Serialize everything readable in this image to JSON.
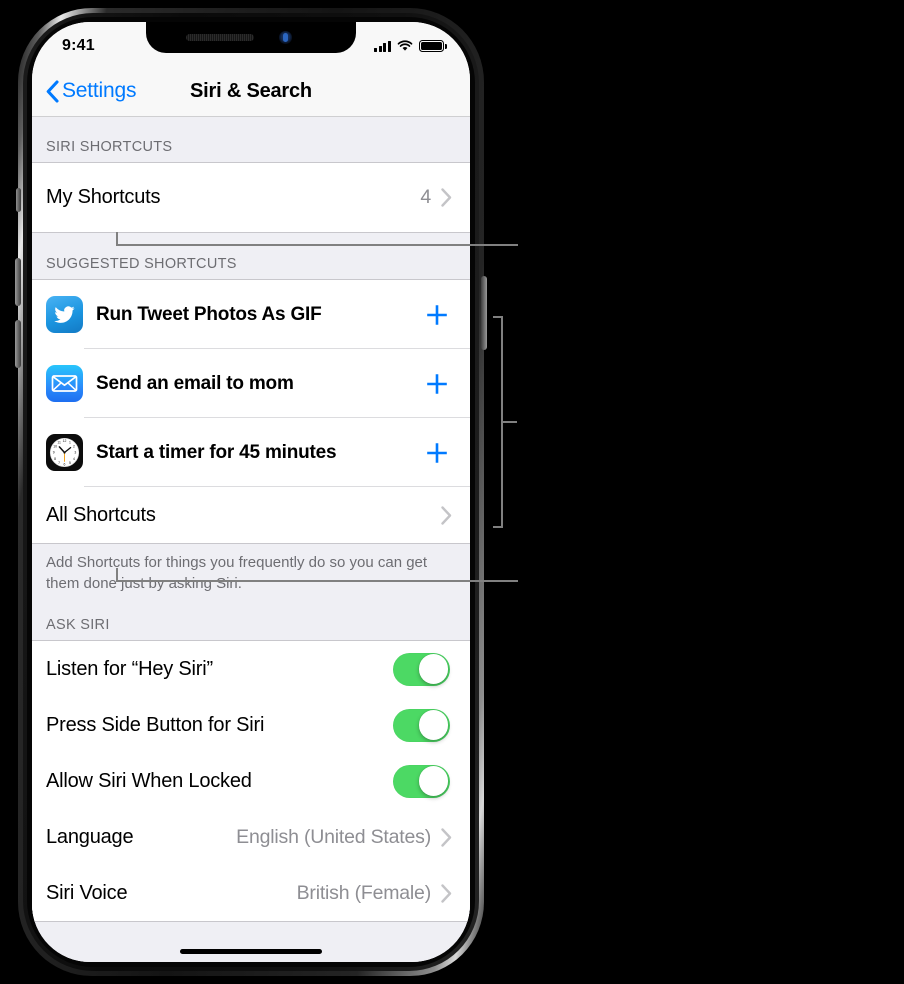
{
  "device": {
    "status_bar": {
      "time": "9:41",
      "cellular_icon": "signal-bars-icon",
      "wifi_icon": "wifi-icon",
      "battery_icon": "battery-full-icon"
    },
    "home_indicator": "home-indicator"
  },
  "navbar": {
    "back_label": "Settings",
    "back_icon": "chevron-left-icon",
    "title": "Siri & Search"
  },
  "sections": [
    {
      "header": "SIRI SHORTCUTS",
      "rows": [
        {
          "title": "My Shortcuts",
          "value": "4",
          "accessory": "chevron-right-icon"
        }
      ]
    },
    {
      "header": "SUGGESTED SHORTCUTS",
      "rows": [
        {
          "title": "Run Tweet Photos As GIF",
          "icon": "twitter-app-icon",
          "accessory": "plus-icon"
        },
        {
          "title": "Send an email to mom",
          "icon": "mail-app-icon",
          "accessory": "plus-icon"
        },
        {
          "title": "Start a timer for 45 minutes",
          "icon": "clock-app-icon",
          "accessory": "plus-icon"
        },
        {
          "title": "All Shortcuts",
          "accessory": "chevron-right-icon"
        }
      ],
      "footer": "Add Shortcuts for things you frequently do so you can get them done just by asking Siri."
    },
    {
      "header": "ASK SIRI",
      "rows": [
        {
          "title": "Listen for “Hey Siri”",
          "toggle": "on"
        },
        {
          "title": "Press Side Button for Siri",
          "toggle": "on"
        },
        {
          "title": "Allow Siri When Locked",
          "toggle": "on"
        },
        {
          "title": "Language",
          "value": "English (United States)",
          "accessory": "chevron-right-icon"
        },
        {
          "title": "Siri Voice",
          "value": "British (Female)",
          "accessory": "chevron-right-icon"
        }
      ]
    }
  ],
  "callouts": {
    "line_color": "#808080",
    "items": [
      {
        "name": "callout-my-shortcuts"
      },
      {
        "name": "callout-suggested-shortcuts-bracket"
      },
      {
        "name": "callout-all-shortcuts"
      }
    ]
  },
  "colors": {
    "tint": "#007AFF",
    "toggle_on": "#4CD964",
    "group_background": "#FFFFFF",
    "table_background": "#EFEFF4",
    "secondary_text": "#8E8E93",
    "header_text": "#6D6D72"
  }
}
